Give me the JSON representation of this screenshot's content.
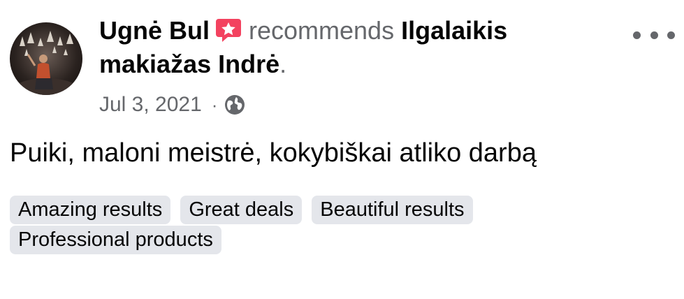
{
  "post": {
    "author_name": "Ugnė Bul",
    "recommend_icon": "recommendation-star-icon",
    "verb": "recommends",
    "page_name": "Ilgalaikis makiažas Indrė",
    "period": ".",
    "date": "Jul 3, 2021",
    "separator": "·",
    "privacy_icon": "globe-icon",
    "more_icon": "more-options-icon",
    "review_text": "Puiki, maloni meistrė, kokybiškai atliko darbą",
    "tags": [
      "Amazing results",
      "Great deals",
      "Beautiful results",
      "Professional products"
    ]
  },
  "colors": {
    "primary_text": "#050505",
    "secondary_text": "#65676b",
    "tag_background": "#e4e6eb",
    "recommend_red": "#f3425f"
  }
}
